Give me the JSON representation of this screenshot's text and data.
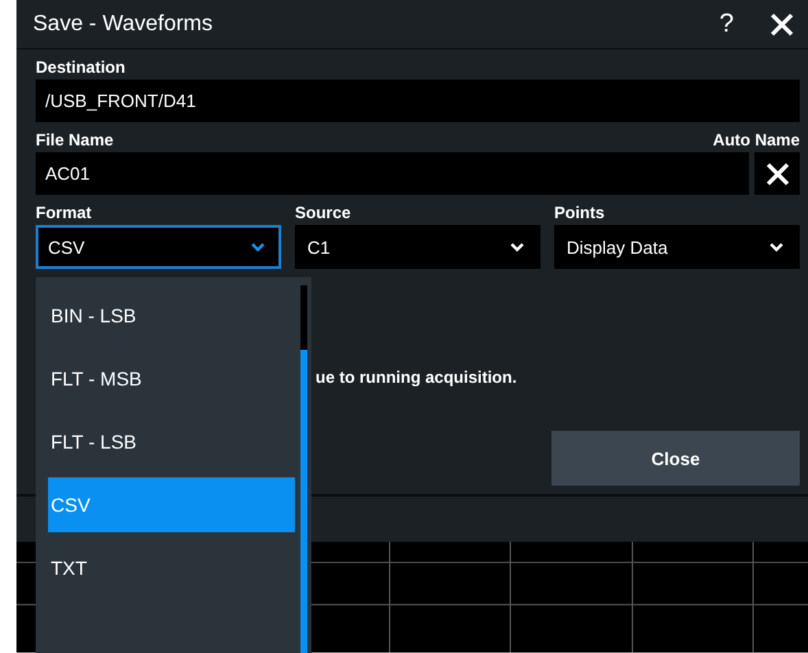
{
  "window": {
    "title": "Save - Waveforms",
    "help": "?"
  },
  "destination": {
    "label": "Destination",
    "value": "/USB_FRONT/D41"
  },
  "file_name": {
    "label": "File Name",
    "value": "AC01",
    "auto_name_label": "Auto Name"
  },
  "selects": [
    {
      "label": "Format",
      "value": "CSV",
      "focused": true
    },
    {
      "label": "Source",
      "value": "C1",
      "focused": false
    },
    {
      "label": "Points",
      "value": "Display Data",
      "focused": false
    }
  ],
  "message": "ue to running acquisition.",
  "buttons": [
    "Close"
  ],
  "format_menu": [
    {
      "label": "BIN - LSB",
      "selected": false
    },
    {
      "label": "FLT - MSB",
      "selected": false
    },
    {
      "label": "FLT - LSB",
      "selected": false
    },
    {
      "label": "CSV",
      "selected": true
    },
    {
      "label": "TXT",
      "selected": false
    }
  ]
}
